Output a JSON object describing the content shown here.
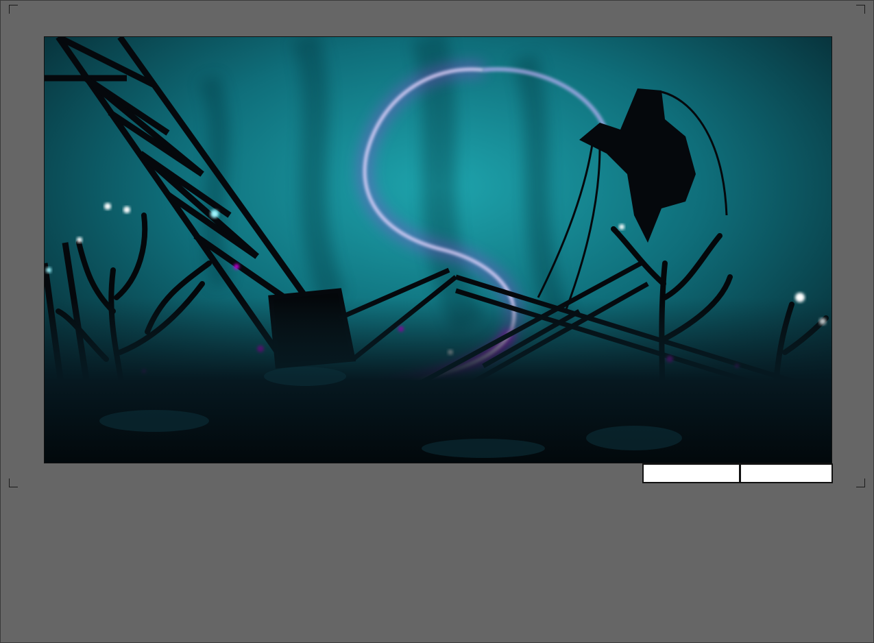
{
  "page": {
    "background_color": "#666666"
  },
  "artwork": {
    "description_icon": "underwater-scene-image",
    "palette": {
      "water_light": "#138a95",
      "water_dark": "#061b22",
      "glow_magenta": "#c000d8",
      "glow_core": "#ffd6ff",
      "silhouette": "#05080c"
    }
  },
  "caption_boxes": [
    {
      "text": ""
    },
    {
      "text": ""
    }
  ]
}
